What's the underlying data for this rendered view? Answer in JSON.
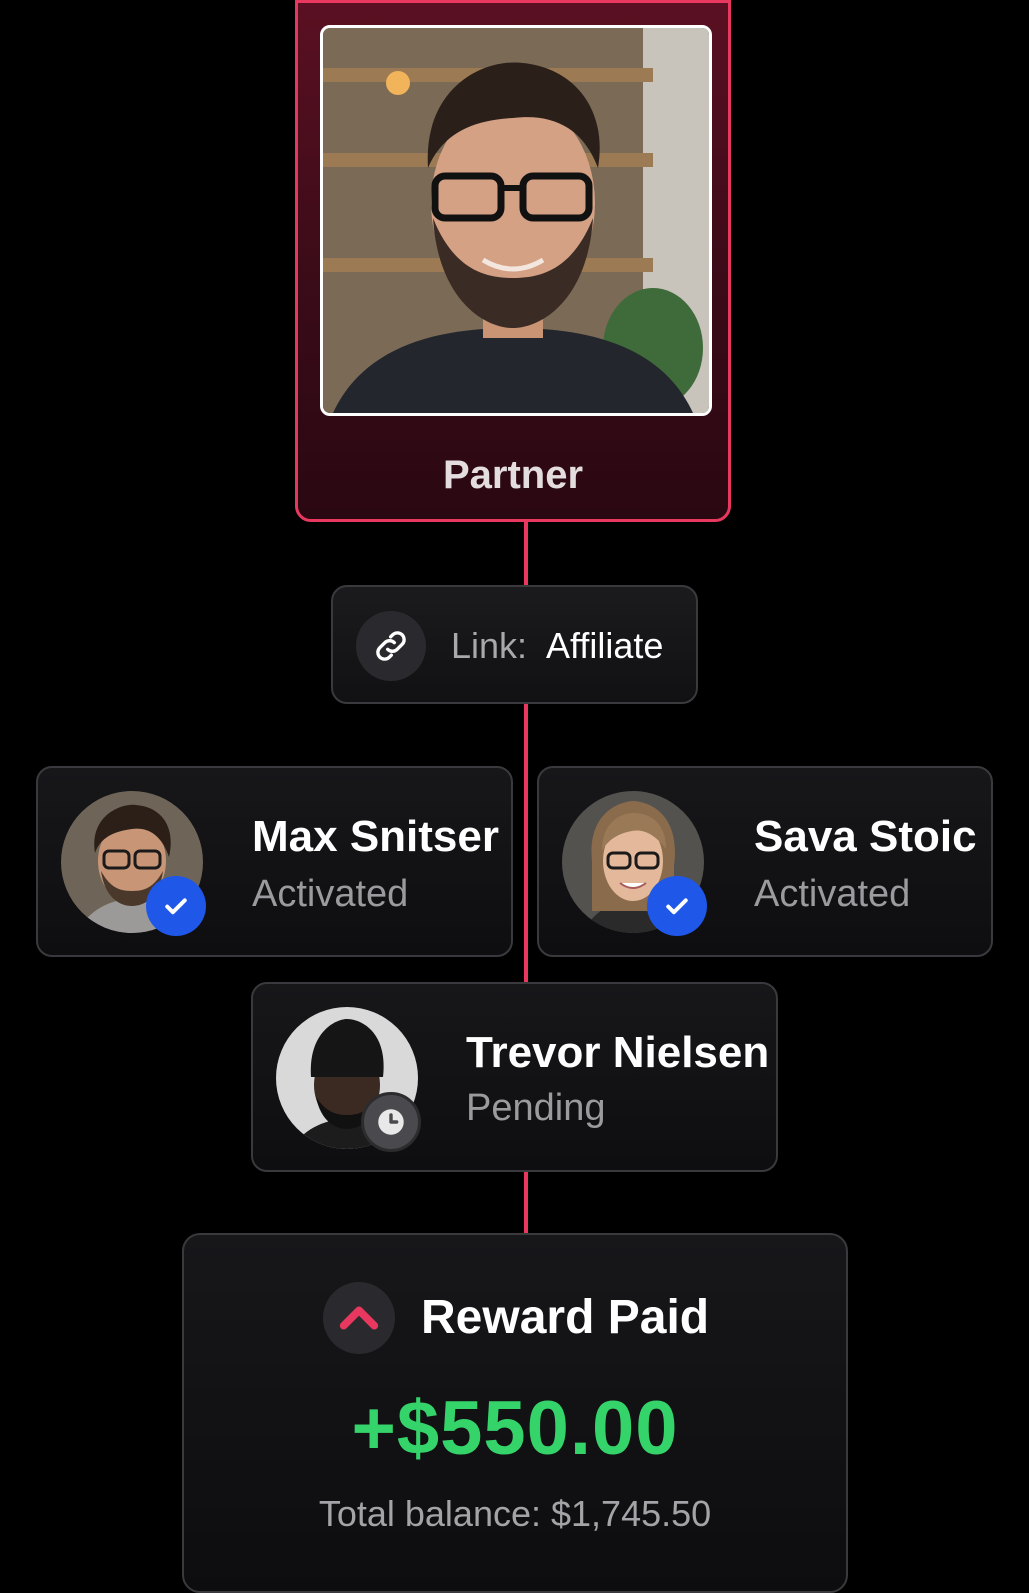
{
  "partner": {
    "title": "Partner"
  },
  "link": {
    "label": "Link:",
    "value": "Affiliate",
    "icon": "link-icon"
  },
  "referrals": [
    {
      "name": "Max Snitser",
      "status": "Activated",
      "status_icon": "check-icon"
    },
    {
      "name": "Sava Stoic",
      "status": "Activated",
      "status_icon": "check-icon"
    },
    {
      "name": "Trevor Nielsen",
      "status": "Pending",
      "status_icon": "clock-icon"
    }
  ],
  "reward": {
    "title": "Reward Paid",
    "icon": "chevron-up-icon",
    "amount": "+$550.00",
    "balance": "Total balance: $1,745.50"
  },
  "colors": {
    "accent": "#e8385f",
    "success": "#35d46a",
    "verified": "#1f57e8"
  }
}
